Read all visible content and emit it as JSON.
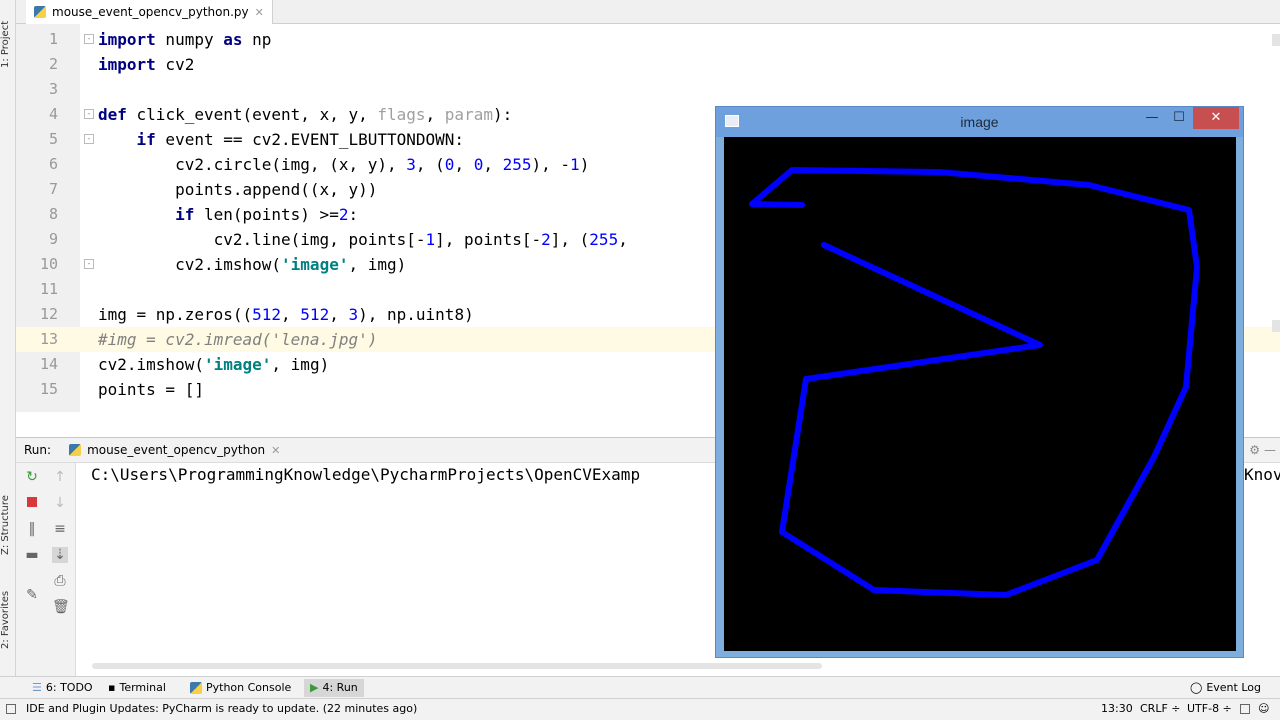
{
  "editor": {
    "tab_name": "mouse_event_opencv_python.py",
    "lines": [
      {
        "n": "1",
        "html": "<span class='kw'>import</span> numpy <span class='kw'>as</span> np"
      },
      {
        "n": "2",
        "html": "<span class='kw'>import</span> cv2"
      },
      {
        "n": "3",
        "html": ""
      },
      {
        "n": "4",
        "html": "<span class='kw'>def</span> click_event(event, x, y, <span class='unused'>flags</span>, <span class='unused'>param</span>):"
      },
      {
        "n": "5",
        "html": "    <span class='kw'>if</span> event == cv2.EVENT_LBUTTONDOWN:"
      },
      {
        "n": "6",
        "html": "        cv2.circle(img, (x, y), <span class='num'>3</span>, (<span class='num'>0</span>, <span class='num'>0</span>, <span class='num'>255</span>), -<span class='num'>1</span>)"
      },
      {
        "n": "7",
        "html": "        points.append((x, y))"
      },
      {
        "n": "8",
        "html": "        <span class='kw'>if</span> len(points) >=<span class='num'>2</span>:"
      },
      {
        "n": "9",
        "html": "            cv2.line(img, points[-<span class='num'>1</span>], points[-<span class='num'>2</span>], (<span class='num'>255</span>,"
      },
      {
        "n": "10",
        "html": "        cv2.imshow(<span class='str'>'image'</span>, img)"
      },
      {
        "n": "11",
        "html": ""
      },
      {
        "n": "12",
        "html": "img = np.zeros((<span class='num'>512</span>, <span class='num'>512</span>, <span class='num'>3</span>), np.uint8)"
      },
      {
        "n": "13",
        "html": "<span class='cmt'>#img = cv2.imread('lena.jpg')</span>"
      },
      {
        "n": "14",
        "html": "cv2.imshow(<span class='str'>'image'</span>, img)"
      },
      {
        "n": "15",
        "html": "points = []"
      }
    ]
  },
  "left_strip": {
    "project": "1: Project",
    "structure": "Z: Structure",
    "favorites": "2: Favorites"
  },
  "run": {
    "label": "Run:",
    "tab_name": "mouse_event_opencv_python",
    "console_text": "C:\\Users\\ProgrammingKnowledge\\PycharmProjects\\OpenCVExamp",
    "console_tail": "Knov"
  },
  "bottom_tabs": [
    "6: TODO",
    "Terminal",
    "Python Console",
    "4: Run"
  ],
  "event_log": "Event Log",
  "status": {
    "message": "IDE and Plugin Updates: PyCharm is ready to update. (22 minutes ago)",
    "position": "13:30",
    "line_sep": "CRLF ÷",
    "encoding": "UTF-8 ÷"
  },
  "image_window": {
    "title": "image",
    "minimize": "—",
    "maximize": "☐",
    "close": "✕"
  },
  "colors": {
    "stroke": "#0000ff",
    "canvas": "#000000",
    "title_bar": "#6da0dc"
  }
}
